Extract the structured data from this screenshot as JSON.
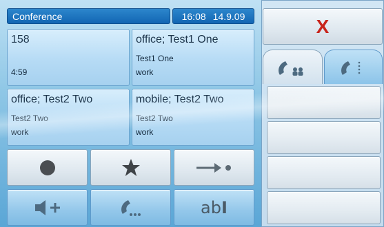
{
  "header": {
    "title": "Conference",
    "time": "16:08",
    "date": "14.9.09"
  },
  "participants": [
    {
      "name": "158",
      "line1": "",
      "line2": "4:59"
    },
    {
      "name": "office; Test1 One",
      "line1": "Test1 One",
      "line2": "work"
    },
    {
      "name": "office; Test2 Two",
      "line1": "Test2 Two",
      "line2": "work"
    },
    {
      "name": "mobile; Test2 Two",
      "line1": "Test2 Two",
      "line2": "work"
    }
  ],
  "controls": {
    "rename_glyph": "ab"
  },
  "close": {
    "label": "X",
    "color": "#c8241b"
  },
  "tabs": [
    {
      "icon": "phone-conference-icon",
      "active": true
    },
    {
      "icon": "phone-keypad-icon",
      "active": false
    }
  ],
  "colors": {
    "title_bar": "#1a72bd",
    "tile": "#b6dbf5",
    "close": "#c8241b"
  }
}
